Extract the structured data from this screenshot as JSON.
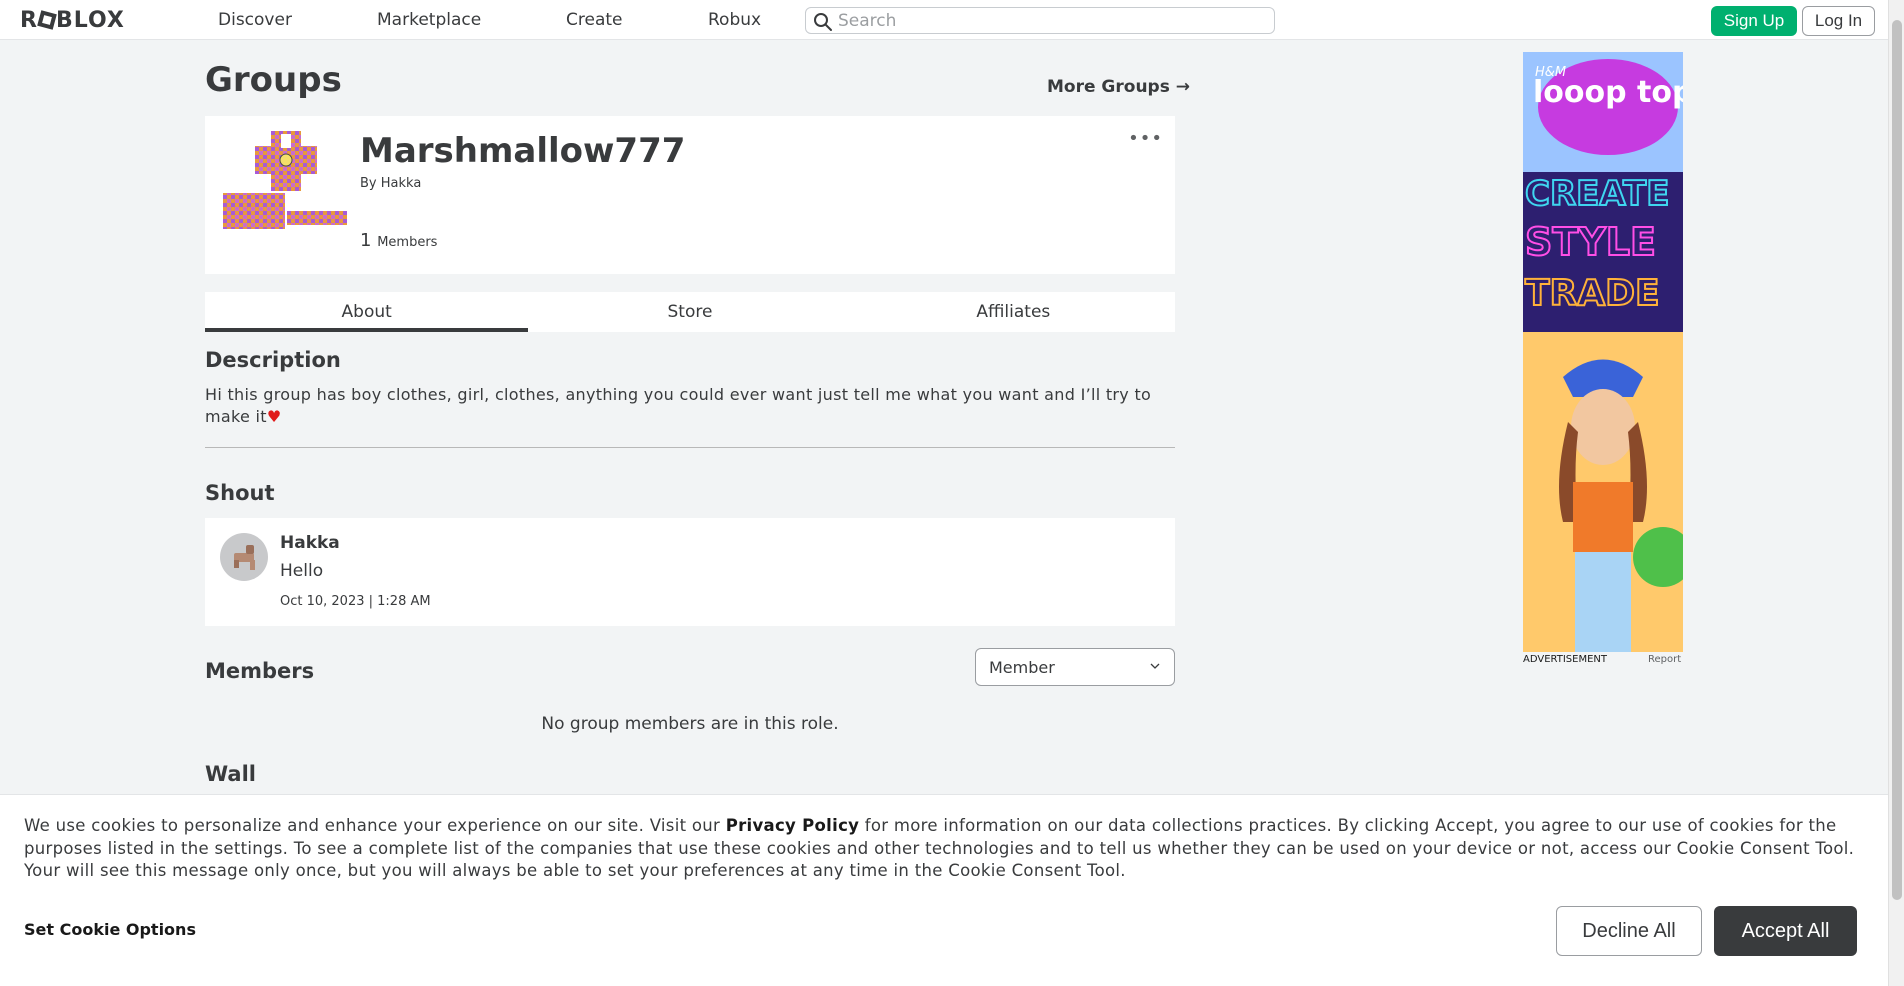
{
  "nav": {
    "logo_text": "ROBLOX",
    "links": [
      "Discover",
      "Marketplace",
      "Create",
      "Robux"
    ],
    "search_placeholder": "Search",
    "signup_label": "Sign Up",
    "login_label": "Log In"
  },
  "page": {
    "title": "Groups",
    "more_groups_label": "More Groups",
    "more_groups_arrow": "→"
  },
  "group": {
    "name": "Marshmallow777",
    "by_prefix": "By",
    "owner": "Hakka",
    "member_count": "1",
    "member_label": "Members",
    "more_icon": "•••"
  },
  "tabs": [
    "About",
    "Store",
    "Affiliates"
  ],
  "about": {
    "description_title": "Description",
    "description_text": "Hi this group has boy clothes, girl, clothes, anything you could ever want just tell me what you want and I’ll try to make it",
    "heart_glyph": "♥"
  },
  "shout": {
    "title": "Shout",
    "user": "Hakka",
    "body": "Hello",
    "date": "Oct 10, 2023 | 1:28 AM"
  },
  "members": {
    "title": "Members",
    "role_selected": "Member",
    "empty_message": "No group members are in this role."
  },
  "wall": {
    "title": "Wall"
  },
  "ad": {
    "label": "ADVERTISEMENT",
    "report": "Report",
    "brand": "H&M",
    "headline": "looop topia",
    "words": [
      "CREATE",
      "STYLE",
      "TRADE"
    ]
  },
  "cookie": {
    "text_before": "We use cookies to personalize and enhance your experience on our site. Visit our ",
    "privacy_policy": "Privacy Policy",
    "text_after": " for more information on our data collections practices. By clicking Accept, you agree to our use of cookies for the purposes listed in the settings. To see a complete list of the companies that use these cookies and other technologies and to tell us whether they can be used on your device or not, access our Cookie Consent Tool. Your will see this message only once, but you will always be able to set your preferences at any time in the Cookie Consent Tool.",
    "options_label": "Set Cookie Options",
    "decline_label": "Decline All",
    "accept_label": "Accept All"
  },
  "colors": {
    "accent_green": "#00b06f",
    "text_dark": "#393b3d",
    "page_bg": "#f2f4f5"
  }
}
